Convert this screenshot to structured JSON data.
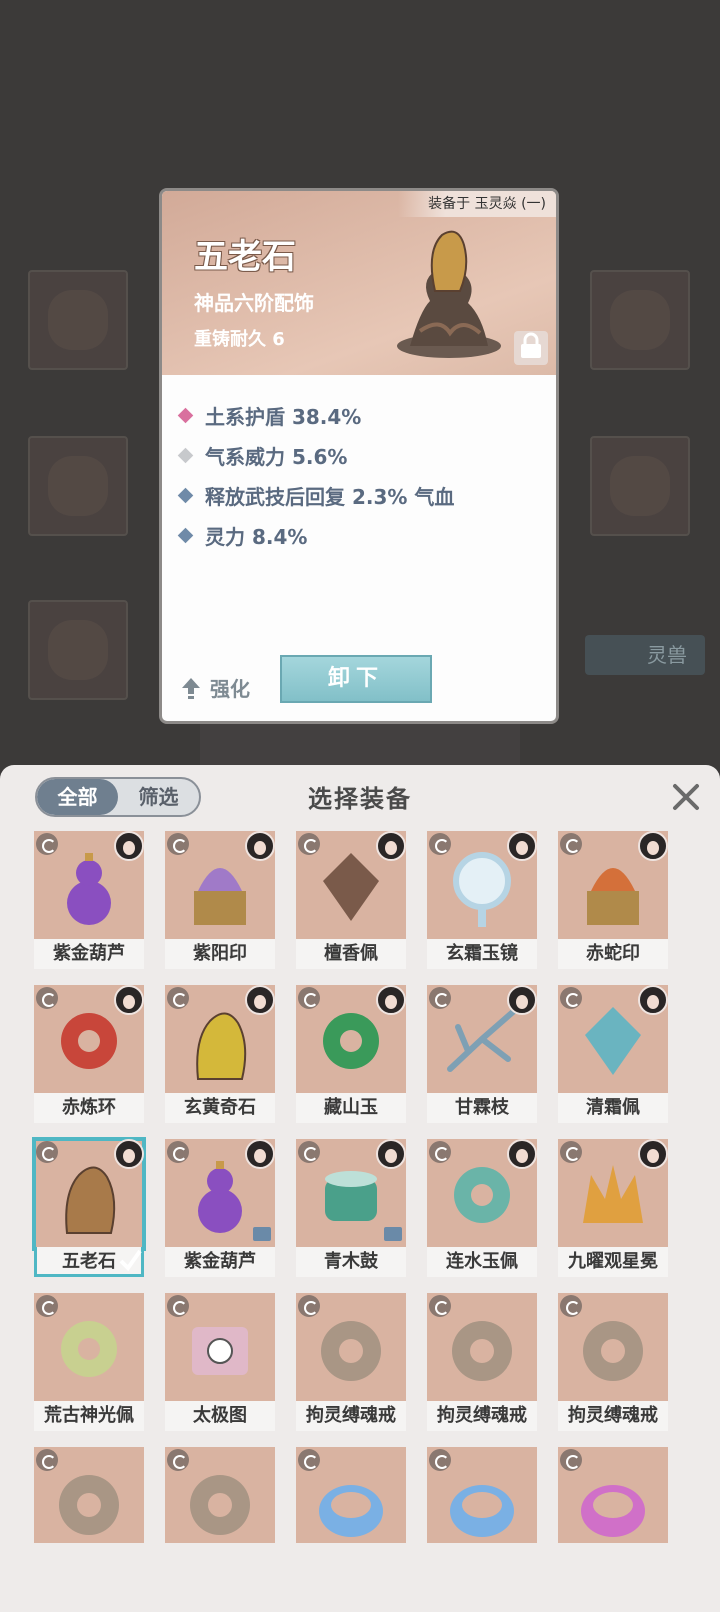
{
  "background": {
    "tag_label": "灵兽"
  },
  "card": {
    "equipped_on": "装备于 玉灵焱 (一)",
    "title": "五老石",
    "grade": "神品六阶配饰",
    "durability": "重铸耐久 6",
    "stats": [
      {
        "text": "土系护盾 38.4%",
        "color": "#d9709e"
      },
      {
        "text": "气系威力 5.6%",
        "color": "#c7c9cc"
      },
      {
        "text": "释放武技后回复 2.3% 气血",
        "color": "#6f8aa8"
      },
      {
        "text": "灵力 8.4%",
        "color": "#6f8aa8"
      }
    ],
    "enhance_label": "强化",
    "unequip_label": "卸下"
  },
  "panel": {
    "filter_all": "全部",
    "filter_select": "筛选",
    "title": "选择装备",
    "items": [
      {
        "name": "紫金葫芦",
        "icon": "gourd-icon",
        "color": "#8a4fc0"
      },
      {
        "name": "紫阳印",
        "icon": "seal-icon",
        "color": "#a07ac8"
      },
      {
        "name": "檀香佩",
        "icon": "pendant-icon",
        "color": "#7a5a4a"
      },
      {
        "name": "玄霜玉镜",
        "icon": "mirror-icon",
        "color": "#b6d4e4"
      },
      {
        "name": "赤蛇印",
        "icon": "serpent-seal-icon",
        "color": "#d4703a"
      },
      {
        "name": "赤炼环",
        "icon": "flame-ring-icon",
        "color": "#c8463a"
      },
      {
        "name": "玄黄奇石",
        "icon": "stone-icon",
        "color": "#d4b83a"
      },
      {
        "name": "藏山玉",
        "icon": "jade-icon",
        "color": "#3a9a5a"
      },
      {
        "name": "甘霖枝",
        "icon": "branch-icon",
        "color": "#7ea0b4"
      },
      {
        "name": "清霜佩",
        "icon": "frost-pendant-icon",
        "color": "#6ab4c0"
      },
      {
        "name": "五老石",
        "icon": "stone-icon",
        "color": "#a87a4a",
        "selected": true
      },
      {
        "name": "紫金葫芦",
        "icon": "gourd-icon",
        "color": "#8a4fc0",
        "locked": true
      },
      {
        "name": "青木鼓",
        "icon": "drum-icon",
        "color": "#4aa08a",
        "locked": true
      },
      {
        "name": "连水玉佩",
        "icon": "water-jade-icon",
        "color": "#6ab4a8"
      },
      {
        "name": "九曜观星冕",
        "icon": "crown-icon",
        "color": "#e0a040"
      },
      {
        "name": "荒古神光佩",
        "icon": "ancient-pendant-icon",
        "color": "#c8d090"
      },
      {
        "name": "太极图",
        "icon": "taiji-scroll-icon",
        "color": "#e0b8c8"
      },
      {
        "name": "拘灵缚魂戒",
        "icon": "ring-icon",
        "color": "#a09080"
      },
      {
        "name": "拘灵缚魂戒",
        "icon": "ring-icon",
        "color": "#a09080"
      },
      {
        "name": "拘灵缚魂戒",
        "icon": "ring-icon",
        "color": "#a09080"
      },
      {
        "name": "",
        "icon": "ring-icon",
        "color": "#a09080"
      },
      {
        "name": "",
        "icon": "ring-icon",
        "color": "#a09080"
      },
      {
        "name": "",
        "icon": "bracelet-icon",
        "color": "#7ab0e4"
      },
      {
        "name": "",
        "icon": "bracelet-icon",
        "color": "#7ab0e4"
      },
      {
        "name": "",
        "icon": "bracelet-icon",
        "color": "#d070c8"
      }
    ]
  }
}
